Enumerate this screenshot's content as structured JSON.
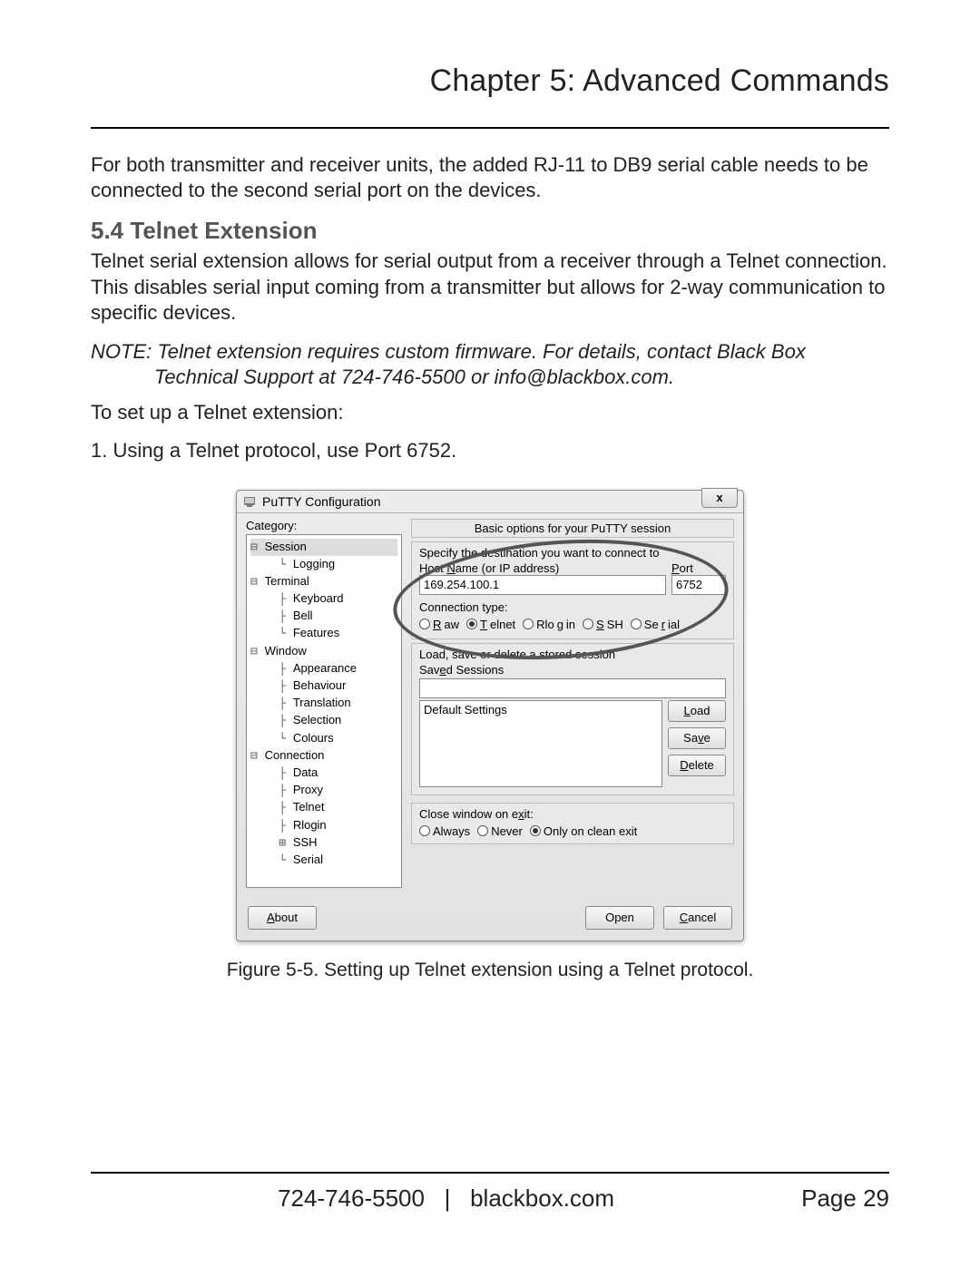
{
  "chapter_title": "Chapter 5: Advanced Commands",
  "intro_para": "For both transmitter and receiver units, the added RJ-11 to DB9 serial cable needs to be connected to the second serial port on the devices.",
  "section_heading": "5.4 Telnet Extension",
  "section_para": "Telnet serial extension allows for serial output from a receiver through a Telnet connection. This disables serial input coming from a transmitter but allows for 2-way communication to specific devices.",
  "note_line1": "NOTE: Telnet extension requires custom firmware. For details, contact Black Box",
  "note_line2": "Technical Support at 724-746-5500 or info@blackbox.com.",
  "setup_line": "To set up a Telnet extension:",
  "step1": "1. Using a Telnet protocol, use Port 6752.",
  "figure_caption": "Figure 5-5. Setting up Telnet extension using a Telnet protocol.",
  "footer_phone": "724-746-5500",
  "footer_sep": "|",
  "footer_site": "blackbox.com",
  "footer_page": "Page 29",
  "putty": {
    "title": "PuTTY Configuration",
    "close_x": "x",
    "category_label": "Category:",
    "tree": [
      {
        "glyph": "⊟ ",
        "label": "Session",
        "selected": true,
        "depth": 0
      },
      {
        "glyph": "└ ",
        "label": "Logging",
        "depth": 1
      },
      {
        "glyph": "⊟ ",
        "label": "Terminal",
        "depth": 0
      },
      {
        "glyph": "├ ",
        "label": "Keyboard",
        "depth": 1
      },
      {
        "glyph": "├ ",
        "label": "Bell",
        "depth": 1
      },
      {
        "glyph": "└ ",
        "label": "Features",
        "depth": 1
      },
      {
        "glyph": "⊟ ",
        "label": "Window",
        "depth": 0
      },
      {
        "glyph": "├ ",
        "label": "Appearance",
        "depth": 1
      },
      {
        "glyph": "├ ",
        "label": "Behaviour",
        "depth": 1
      },
      {
        "glyph": "├ ",
        "label": "Translation",
        "depth": 1
      },
      {
        "glyph": "├ ",
        "label": "Selection",
        "depth": 1
      },
      {
        "glyph": "└ ",
        "label": "Colours",
        "depth": 1
      },
      {
        "glyph": "⊟ ",
        "label": "Connection",
        "depth": 0
      },
      {
        "glyph": "├ ",
        "label": "Data",
        "depth": 1
      },
      {
        "glyph": "├ ",
        "label": "Proxy",
        "depth": 1
      },
      {
        "glyph": "├ ",
        "label": "Telnet",
        "depth": 1
      },
      {
        "glyph": "├ ",
        "label": "Rlogin",
        "depth": 1
      },
      {
        "glyph": "⊞ ",
        "label": "SSH",
        "depth": 1
      },
      {
        "glyph": "└ ",
        "label": "Serial",
        "depth": 1
      }
    ],
    "opts_header": "Basic options for your PuTTY session",
    "dest_legend": "Specify the destination you want to connect to",
    "host_label_pre": "Host ",
    "host_label_u": "N",
    "host_label_post": "ame (or IP address)",
    "port_label_u": "P",
    "port_label_post": "ort",
    "host_value": "169.254.100.1",
    "port_value": "6752",
    "conn_type_label": "Connection type:",
    "radios": [
      {
        "label_u": "R",
        "label_post": "aw",
        "selected": false
      },
      {
        "label_u": "T",
        "label_post": "elnet",
        "selected": true
      },
      {
        "label_pre": "Rlo",
        "label_u": "g",
        "label_post": "in",
        "selected": false
      },
      {
        "label_u": "S",
        "label_post": "SH",
        "selected": false
      },
      {
        "label_pre": "Se",
        "label_u": "r",
        "label_post": "ial",
        "selected": false
      }
    ],
    "stored_legend": "Load, save or delete a stored session",
    "saved_sessions_pre": "Sav",
    "saved_sessions_u": "e",
    "saved_sessions_post": "d Sessions",
    "default_settings": "Default Settings",
    "load_u": "L",
    "load_post": "oad",
    "save_pre": "Sa",
    "save_u": "v",
    "save_post": "e",
    "delete_u": "D",
    "delete_post": "elete",
    "close_exit_pre": "Close window on e",
    "close_exit_u": "x",
    "close_exit_post": "it:",
    "exit_radios": [
      {
        "label": "Always",
        "selected": false
      },
      {
        "label": "Never",
        "selected": false
      },
      {
        "label": "Only on clean exit",
        "selected": true
      }
    ],
    "about_u": "A",
    "about_post": "bout",
    "open_label": "Open",
    "cancel_u": "C",
    "cancel_post": "ancel"
  }
}
